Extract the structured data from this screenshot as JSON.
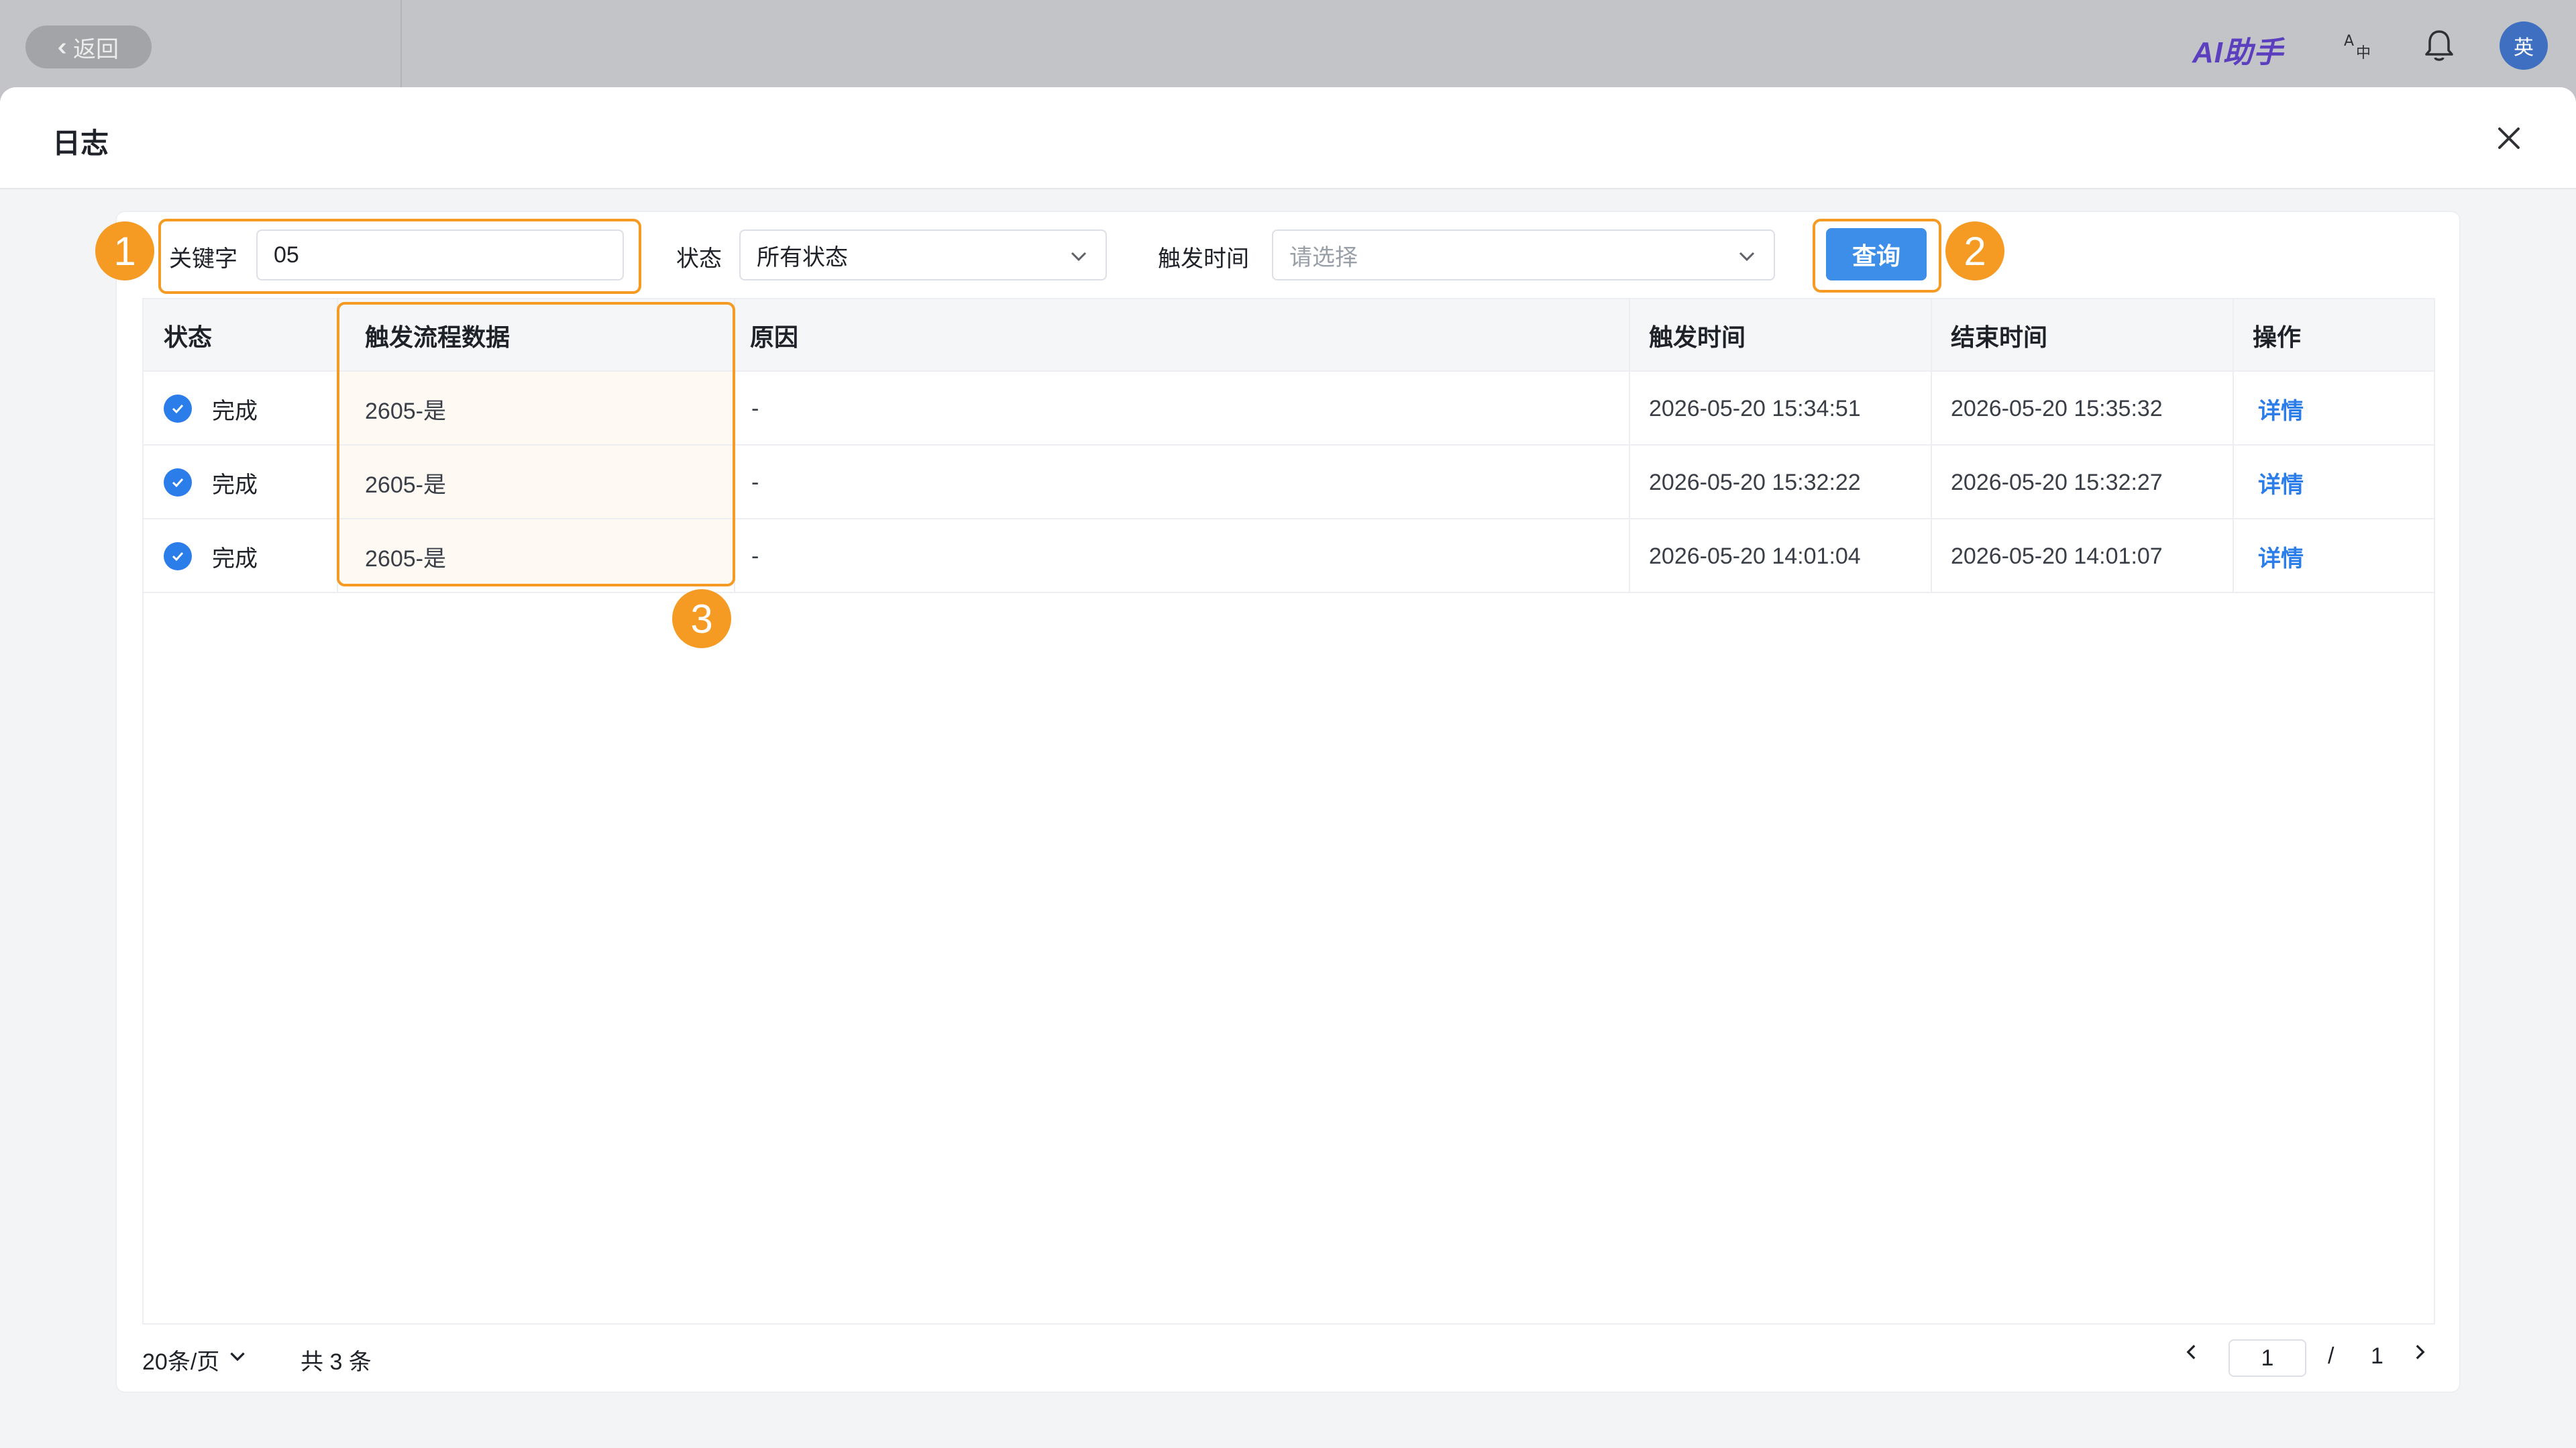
{
  "topbar": {
    "back_label": "返回",
    "ai_label": "AI助手",
    "avatar_text": "英"
  },
  "modal": {
    "title": "日志"
  },
  "filters": {
    "keyword_label": "关键字",
    "keyword_value": "05",
    "status_label": "状态",
    "status_value": "所有状态",
    "trigger_time_label": "触发时间",
    "trigger_time_placeholder": "请选择",
    "query_label": "查询"
  },
  "callouts": [
    "1",
    "2",
    "3"
  ],
  "table": {
    "headers": [
      "状态",
      "触发流程数据",
      "原因",
      "触发时间",
      "结束时间",
      "操作"
    ],
    "rows": [
      {
        "status": "完成",
        "flow_data": "2605-是",
        "reason": "-",
        "trigger_time": "2026-05-20 15:34:51",
        "end_time": "2026-05-20 15:35:32",
        "action": "详情"
      },
      {
        "status": "完成",
        "flow_data": "2605-是",
        "reason": "-",
        "trigger_time": "2026-05-20 15:32:22",
        "end_time": "2026-05-20 15:32:27",
        "action": "详情"
      },
      {
        "status": "完成",
        "flow_data": "2605-是",
        "reason": "-",
        "trigger_time": "2026-05-20 14:01:04",
        "end_time": "2026-05-20 14:01:07",
        "action": "详情"
      }
    ]
  },
  "pagination": {
    "page_size": "20条/页",
    "total": "共 3 条",
    "current_page": "1",
    "separator": "/",
    "total_pages": "1"
  },
  "colors": {
    "accent": "#2b7de9",
    "callout": "#f59a23"
  }
}
